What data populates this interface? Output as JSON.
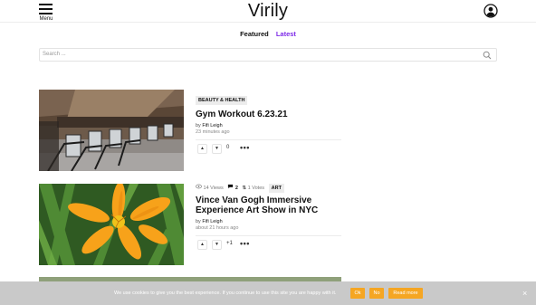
{
  "header": {
    "menu_label": "Menu",
    "logo": "Virily"
  },
  "tabs": [
    {
      "label": "Featured"
    },
    {
      "label": "Latest"
    }
  ],
  "search": {
    "placeholder": "Search ..."
  },
  "posts": [
    {
      "category": "BEAUTY & HEALTH",
      "title": "Gym Workout 6.23.21",
      "by": "by",
      "author": "Fifi Leigh",
      "time": "23 minutes ago",
      "score": "0"
    },
    {
      "views": "14 Views",
      "comments": "2",
      "votes": "1 Votes",
      "category": "ART",
      "title": "Vince Van Gogh Immersive Experience Art Show in NYC",
      "by": "by",
      "author": "Fifi Leigh",
      "time": "about 21 hours ago",
      "score": "+1"
    }
  ],
  "cookie": {
    "text": "We use cookies to give you the best experience. If you continue to use this site you are happy with it.",
    "ok_label": "Ok",
    "no_label": "No",
    "read_more_label": "Read more",
    "close": "×"
  },
  "colors": {
    "accent": "#7d2ae8",
    "cookie_button": "#f5a623",
    "cookie_bar": "#c9c9c9"
  },
  "icons": {
    "menu": "hamburger-icon",
    "user": "user-icon",
    "search": "search-icon",
    "upvote": "arrow-up-icon",
    "downvote": "arrow-down-icon",
    "more": "more-dots-icon",
    "views": "eye-icon",
    "comments": "comment-icon",
    "votes": "votes-icon"
  }
}
